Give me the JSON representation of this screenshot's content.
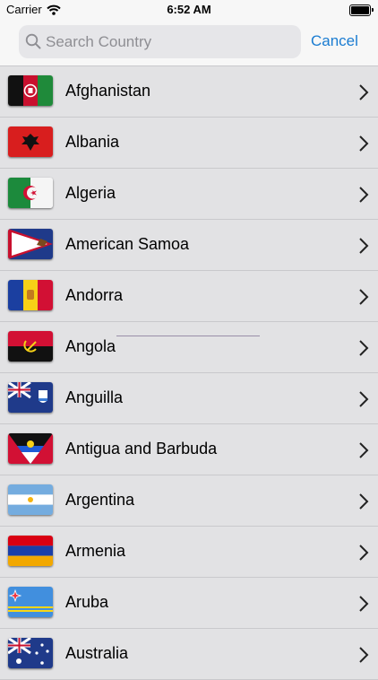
{
  "status_bar": {
    "carrier": "Carrier",
    "time": "6:52 AM",
    "icons": [
      "wifi-icon",
      "battery-icon"
    ]
  },
  "search": {
    "placeholder": "Search Country",
    "value": "",
    "icon": "search-icon",
    "cancel_label": "Cancel"
  },
  "colors": {
    "accent": "#1a7cd1",
    "list_background": "#e2e2e4",
    "separator": "#c9c9cc"
  },
  "countries": [
    {
      "name": "Afghanistan",
      "flag": "afghanistan-flag-icon"
    },
    {
      "name": "Albania",
      "flag": "albania-flag-icon"
    },
    {
      "name": "Algeria",
      "flag": "algeria-flag-icon"
    },
    {
      "name": "American Samoa",
      "flag": "american-samoa-flag-icon"
    },
    {
      "name": "Andorra",
      "flag": "andorra-flag-icon"
    },
    {
      "name": "Angola",
      "flag": "angola-flag-icon"
    },
    {
      "name": "Anguilla",
      "flag": "anguilla-flag-icon"
    },
    {
      "name": "Antigua and Barbuda",
      "flag": "antigua-and-barbuda-flag-icon"
    },
    {
      "name": "Argentina",
      "flag": "argentina-flag-icon"
    },
    {
      "name": "Armenia",
      "flag": "armenia-flag-icon"
    },
    {
      "name": "Aruba",
      "flag": "aruba-flag-icon"
    },
    {
      "name": "Australia",
      "flag": "australia-flag-icon"
    }
  ]
}
